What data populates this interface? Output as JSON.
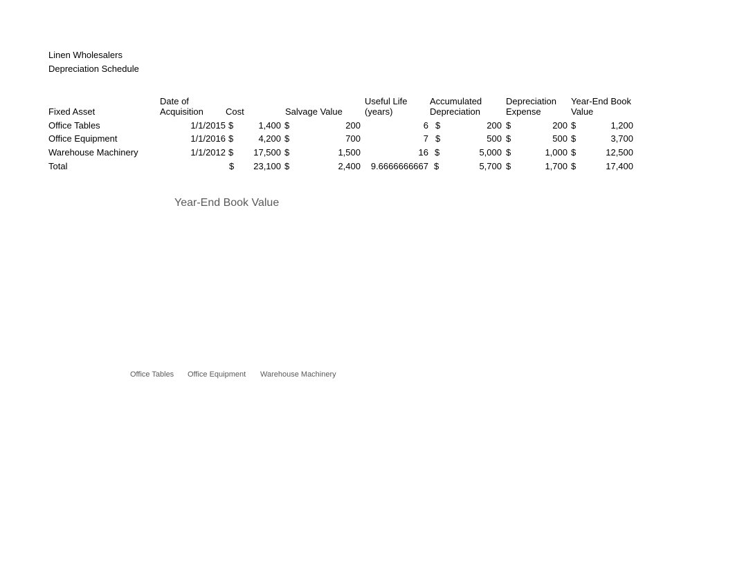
{
  "header": {
    "company": "Linen Wholesalers",
    "title": "Depreciation Schedule"
  },
  "table": {
    "columns": [
      {
        "line1": "",
        "line2": "Fixed Asset"
      },
      {
        "line1": "Date of",
        "line2": "Acquisition"
      },
      {
        "line1": "",
        "line2": "Cost"
      },
      {
        "line1": "",
        "line2": "Salvage Value"
      },
      {
        "line1": "Useful Life",
        "line2": "(years)"
      },
      {
        "line1": "Accumulated",
        "line2": "Depreciation"
      },
      {
        "line1": "Depreciation",
        "line2": "Expense"
      },
      {
        "line1": "Year-End Book",
        "line2": "Value"
      }
    ],
    "currency": "$",
    "rows": [
      {
        "asset": "Office Tables",
        "date": "1/1/2015",
        "cost": "1,400",
        "salvage": "200",
        "life": "6",
        "accum": "200",
        "expense": "200",
        "book": "1,200"
      },
      {
        "asset": "Office Equipment",
        "date": "1/1/2016",
        "cost": "4,200",
        "salvage": "700",
        "life": "7",
        "accum": "500",
        "expense": "500",
        "book": "3,700"
      },
      {
        "asset": "Warehouse Machinery",
        "date": "1/1/2012",
        "cost": "17,500",
        "salvage": "1,500",
        "life": "16",
        "accum": "5,000",
        "expense": "1,000",
        "book": "12,500"
      },
      {
        "asset": "Total",
        "date": "",
        "cost": "23,100",
        "salvage": "2,400",
        "life": "9.6666666667",
        "accum": "5,700",
        "expense": "1,700",
        "book": "17,400"
      }
    ]
  },
  "chart": {
    "title": "Year-End Book Value",
    "legend": [
      "Office Tables",
      "Office Equipment",
      "Warehouse Machinery"
    ]
  }
}
